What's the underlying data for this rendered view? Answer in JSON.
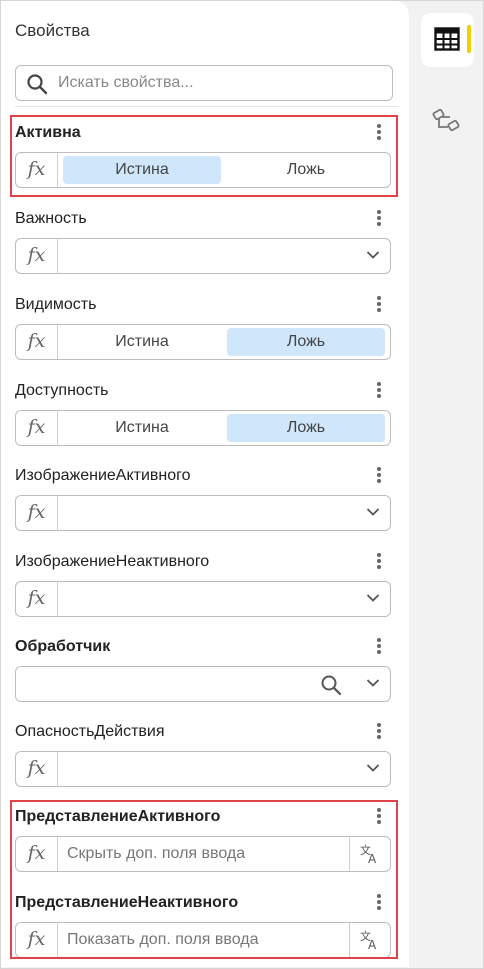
{
  "panel": {
    "title": "Свойства",
    "search_placeholder": "Искать свойства..."
  },
  "properties": [
    {
      "label": "Активна",
      "bold": true,
      "type": "toggle",
      "true_label": "Истина",
      "false_label": "Ложь",
      "selected": "true"
    },
    {
      "label": "Важность",
      "bold": false,
      "type": "select"
    },
    {
      "label": "Видимость",
      "bold": false,
      "type": "toggle",
      "true_label": "Истина",
      "false_label": "Ложь",
      "selected": "false"
    },
    {
      "label": "Доступность",
      "bold": false,
      "type": "toggle",
      "true_label": "Истина",
      "false_label": "Ложь",
      "selected": "false"
    },
    {
      "label": "ИзображениеАктивного",
      "bold": false,
      "type": "select"
    },
    {
      "label": "ИзображениеНеактивного",
      "bold": false,
      "type": "select"
    },
    {
      "label": "Обработчик",
      "bold": true,
      "type": "select-search"
    },
    {
      "label": "ОпасностьДействия",
      "bold": false,
      "type": "select"
    },
    {
      "label": "ПредставлениеАктивного",
      "bold": true,
      "type": "text",
      "value": "Скрыть доп. поля ввода"
    },
    {
      "label": "ПредставлениеНеактивного",
      "bold": true,
      "type": "text",
      "value": "Показать доп. поля ввода"
    }
  ],
  "fx_symbol": "fx",
  "icons": {
    "search": "search-icon",
    "more": "more-vertical-icon",
    "chevron": "chevron-down-icon",
    "translate": "translate-icon",
    "tab_properties": "table-icon",
    "tab_structure": "tree-structure-icon"
  },
  "colors": {
    "toggle_selected": "#cfe6fb",
    "highlight": "#e0424a",
    "active_tab_marker": "#f2cf00"
  }
}
